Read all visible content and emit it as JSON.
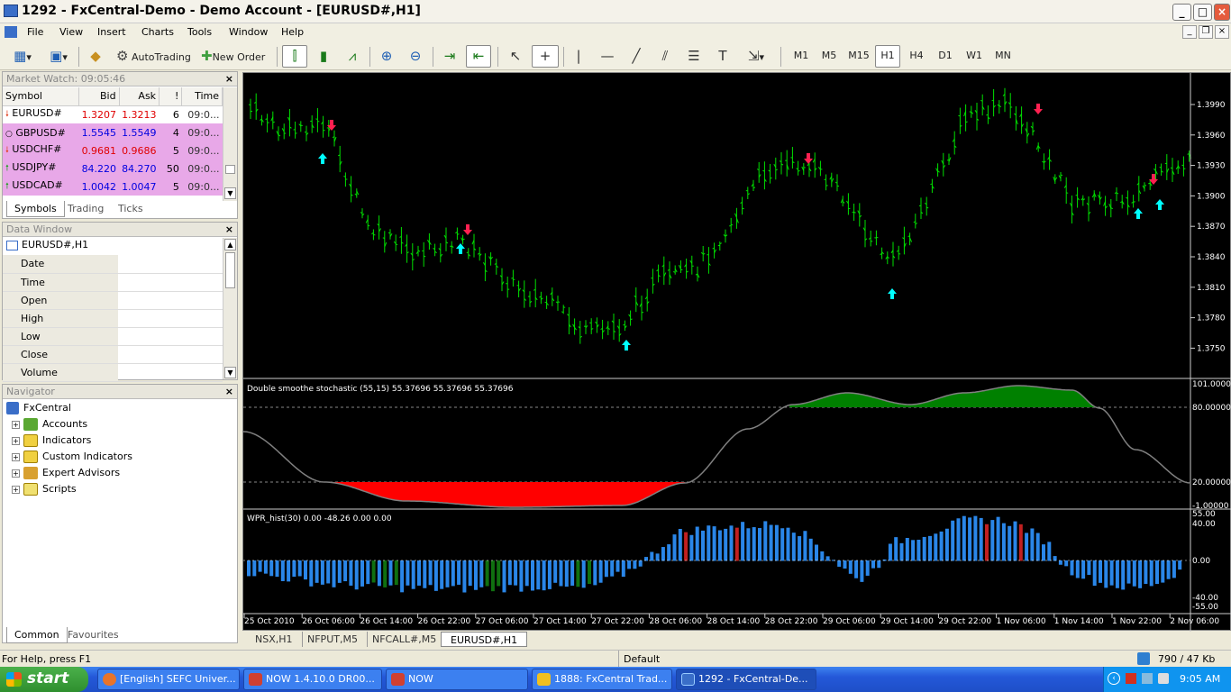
{
  "window": {
    "title": "1292 - FxCentral-Demo - Demo Account - [EURUSD#,H1]",
    "min": "_",
    "max": "□",
    "close": "×"
  },
  "menu": [
    "File",
    "View",
    "Insert",
    "Charts",
    "Tools",
    "Window",
    "Help"
  ],
  "toolbar": {
    "autotrading": "AutoTrading",
    "new_order": "New Order",
    "timeframes": [
      "M1",
      "M5",
      "M15",
      "H1",
      "H4",
      "D1",
      "W1",
      "MN"
    ],
    "active_tf": "H1"
  },
  "market_watch": {
    "title": "Market Watch: 09:05:46",
    "cols": [
      "Symbol",
      "Bid",
      "Ask",
      "!",
      "Time"
    ],
    "rows": [
      {
        "sym": "EURUSD#",
        "bid": "1.3207",
        "ask": "1.3213",
        "spread": "6",
        "time": "09:0...",
        "dir": "down"
      },
      {
        "sym": "GBPUSD#",
        "bid": "1.5545",
        "ask": "1.5549",
        "spread": "4",
        "time": "09:0...",
        "dir": "none"
      },
      {
        "sym": "USDCHF#",
        "bid": "0.9681",
        "ask": "0.9686",
        "spread": "5",
        "time": "09:0...",
        "dir": "down"
      },
      {
        "sym": "USDJPY#",
        "bid": "84.220",
        "ask": "84.270",
        "spread": "50",
        "time": "09:0...",
        "dir": "up"
      },
      {
        "sym": "USDCAD#",
        "bid": "1.0042",
        "ask": "1.0047",
        "spread": "5",
        "time": "09:0...",
        "dir": "up"
      }
    ],
    "tabs": [
      "Symbols",
      "Trading",
      "Ticks"
    ]
  },
  "data_window": {
    "title": "Data Window",
    "symbol": "EURUSD#,H1",
    "fields": [
      "Date",
      "Time",
      "Open",
      "High",
      "Low",
      "Close",
      "Volume"
    ]
  },
  "navigator": {
    "title": "Navigator",
    "root": "FxCentral",
    "items": [
      "Accounts",
      "Indicators",
      "Custom Indicators",
      "Expert Advisors",
      "Scripts"
    ],
    "tabs": [
      "Common",
      "Favourites"
    ]
  },
  "chart": {
    "price_labels": [
      "1.3990",
      "1.3960",
      "1.3930",
      "1.3900",
      "1.3870",
      "1.3840",
      "1.3810",
      "1.3780",
      "1.3750"
    ],
    "stoch_title": "Double smoothe stochastic (55,15) 55.37696 55.37696 55.37696",
    "stoch_labels": [
      "101.00000",
      "80.00000",
      "20.00000",
      "-1.00000"
    ],
    "wpr_title": "WPR_hist(30) 0.00 -48.26 0.00 0.00",
    "wpr_labels": [
      "55.00",
      "40.00",
      "0.00",
      "-40.00",
      "-55.00"
    ],
    "time_labels": [
      "25 Oct 2010",
      "26 Oct 06:00",
      "26 Oct 14:00",
      "26 Oct 22:00",
      "27 Oct 06:00",
      "27 Oct 14:00",
      "27 Oct 22:00",
      "28 Oct 06:00",
      "28 Oct 14:00",
      "28 Oct 22:00",
      "29 Oct 06:00",
      "29 Oct 14:00",
      "29 Oct 22:00",
      "1 Nov 06:00",
      "1 Nov 14:00",
      "1 Nov 22:00",
      "2 Nov 06:00"
    ],
    "colors": {
      "bars": "#00e000",
      "up_arrow": "#00ffff",
      "down_arrow": "#ff2050",
      "hist": "#2a86e8",
      "hist_red": "#c02020",
      "hist_green": "#107010",
      "stoch_line": "#808080",
      "stoch_hi": "#008000",
      "stoch_lo": "#ff0000"
    }
  },
  "chart_tabs": [
    "NSX,H1",
    "NFPUT,M5",
    "NFCALL#,M5",
    "EURUSD#,H1"
  ],
  "status": {
    "help": "For Help, press F1",
    "profile": "Default",
    "traffic": "790 / 47 Kb"
  },
  "taskbar": {
    "start": "start",
    "items": [
      "[English] SEFC Univer...",
      "NOW 1.4.10.0 DR00...",
      "NOW",
      "1888: FxCentral Trad...",
      "1292 - FxCentral-De..."
    ],
    "clock": "9:05 AM"
  }
}
